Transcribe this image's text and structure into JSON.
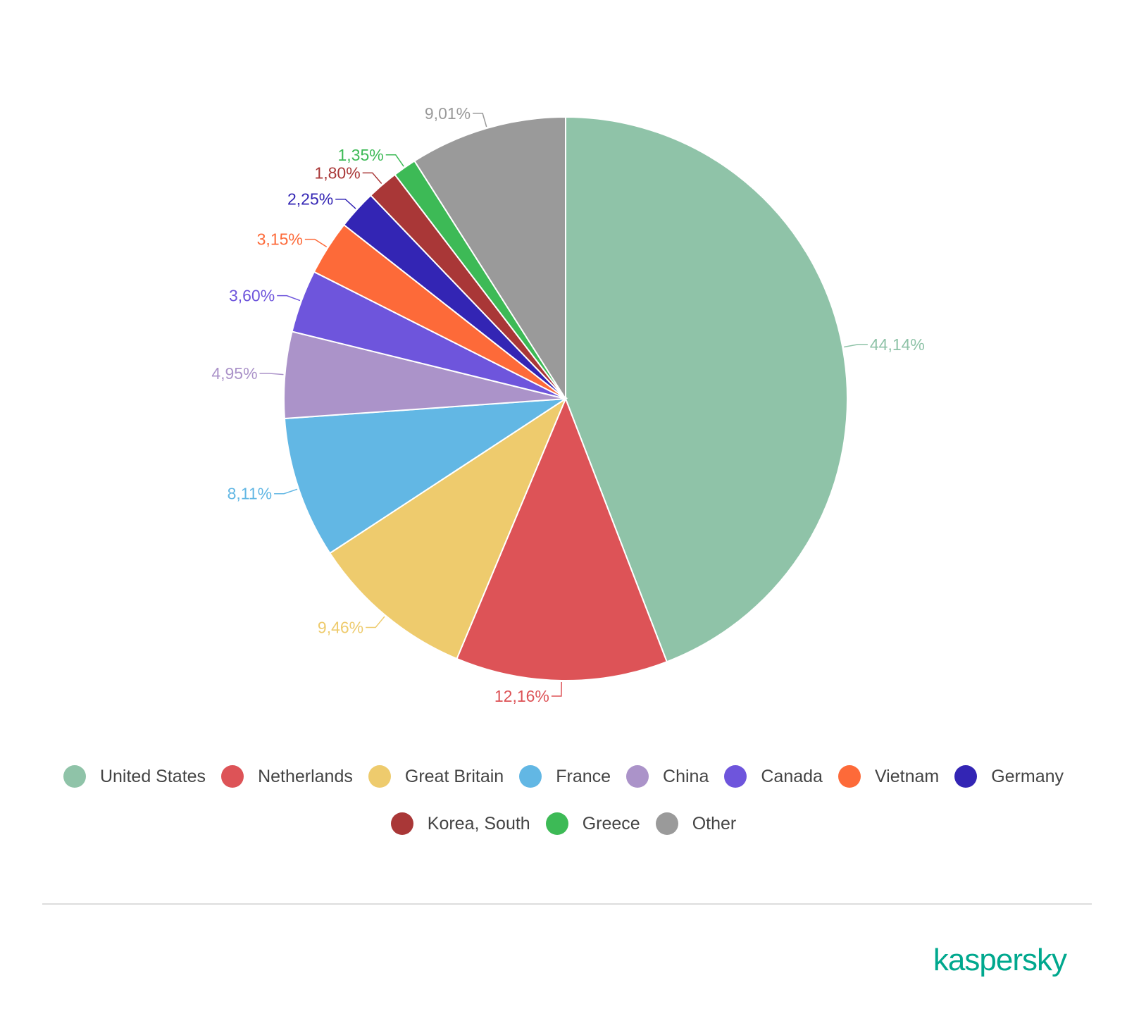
{
  "chart_data": {
    "type": "pie",
    "title": "",
    "start_angle": "12 o'clock",
    "direction": "clockwise",
    "slices": [
      {
        "label": "United States",
        "value": 44.14,
        "display": "44,14%",
        "color": "#8fc3a8"
      },
      {
        "label": "Netherlands",
        "value": 12.16,
        "display": "12,16%",
        "color": "#dd5357"
      },
      {
        "label": "Great Britain",
        "value": 9.46,
        "display": "9,46%",
        "color": "#eecb6d"
      },
      {
        "label": "France",
        "value": 8.11,
        "display": "8,11%",
        "color": "#62b7e4"
      },
      {
        "label": "China",
        "value": 4.95,
        "display": "4,95%",
        "color": "#ab93c9"
      },
      {
        "label": "Canada",
        "value": 3.6,
        "display": "3,60%",
        "color": "#6e55dc"
      },
      {
        "label": "Vietnam",
        "value": 3.15,
        "display": "3,15%",
        "color": "#fd6a39"
      },
      {
        "label": "Germany",
        "value": 2.25,
        "display": "2,25%",
        "color": "#3325b4"
      },
      {
        "label": "Korea, South",
        "value": 1.8,
        "display": "1,80%",
        "color": "#a93737"
      },
      {
        "label": "Greece",
        "value": 1.35,
        "display": "1,35%",
        "color": "#3dba56"
      },
      {
        "label": "Other",
        "value": 9.01,
        "display": "9,01%",
        "color": "#9a9a9a"
      }
    ],
    "legend": {
      "placement": "bottom"
    }
  },
  "brand": {
    "name": "kaspersky",
    "color": "#00a88e"
  }
}
